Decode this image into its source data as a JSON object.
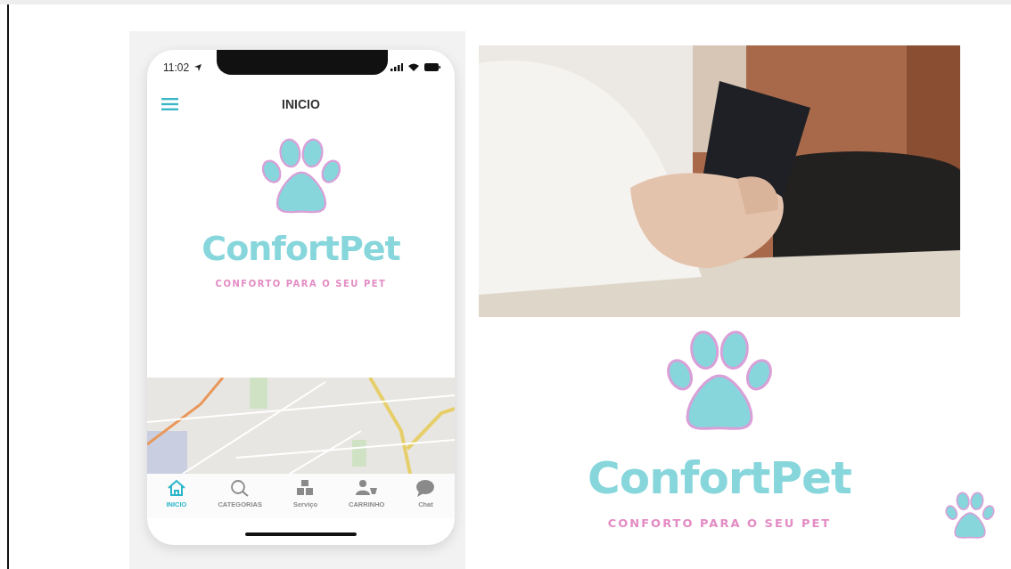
{
  "phone": {
    "status_time": "11:02",
    "title": "INICIO",
    "logo": {
      "name": "ConfortPet",
      "tagline": "CONFORTO PARA O SEU PET"
    },
    "tabs": [
      {
        "label": "INICIO",
        "selected": true
      },
      {
        "label": "CATEGORIAS",
        "selected": false
      },
      {
        "label": "Serviço",
        "selected": false
      },
      {
        "label": "CARRINHO",
        "selected": false
      },
      {
        "label": "Chat",
        "selected": false
      }
    ]
  },
  "brand": {
    "name": "ConfortPet",
    "tagline": "CONFORTO PARA O SEU PET"
  }
}
